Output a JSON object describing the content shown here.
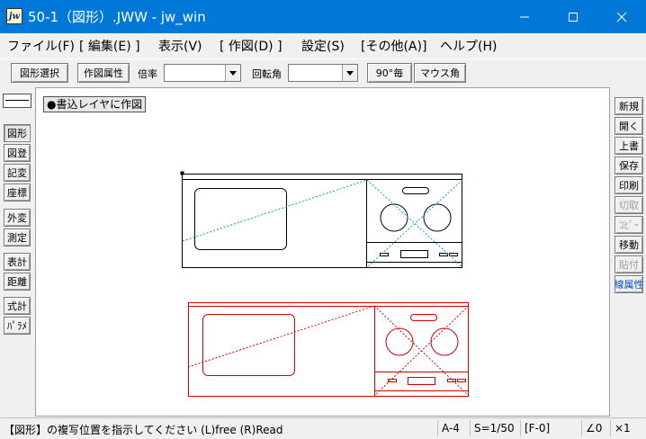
{
  "window": {
    "app_icon_text": "jw",
    "title": "50-1（図形）.JWW - jw_win"
  },
  "menu": [
    "ファイル(F)",
    "[ 編集(E) ]",
    "表示(V)",
    "[ 作図(D) ]",
    "設定(S)",
    "[その他(A)]",
    "ヘルプ(H)"
  ],
  "toolbar": {
    "shape_select": "図形選択",
    "draw_attr": "作図属性",
    "scale_label": "倍率",
    "scale_value": "",
    "rotation_label": "回転角",
    "rotation_value": "",
    "deg90": "90°毎",
    "mouse_angle": "マウス角"
  },
  "left_toolbar": [
    "図形",
    "図登",
    "記変",
    "座標",
    "外変",
    "測定",
    "表計",
    "距離",
    "式計",
    "ﾊﾟﾗﾒ"
  ],
  "right_toolbar": [
    "新規",
    "開く",
    "上書",
    "保存",
    "印刷",
    "切取",
    "ｺﾋﾟｰ",
    "移動",
    "貼付",
    "線属性"
  ],
  "canvas": {
    "layer_label": "●書込レイヤに作図"
  },
  "status": {
    "message": "【図形】の複写位置を指示してください (L)free (R)Read",
    "paper": "A-4",
    "scale": "S=1/50",
    "layer": "[F-0]",
    "angle": "∠0",
    "zoom": "×1"
  },
  "colors": {
    "titlebar": "#0078d7",
    "drawing_black": "#000000",
    "auxiliary_cyan": "#00a0d0",
    "preview_red": "#d00000",
    "accent_blue": "#0050c8"
  }
}
